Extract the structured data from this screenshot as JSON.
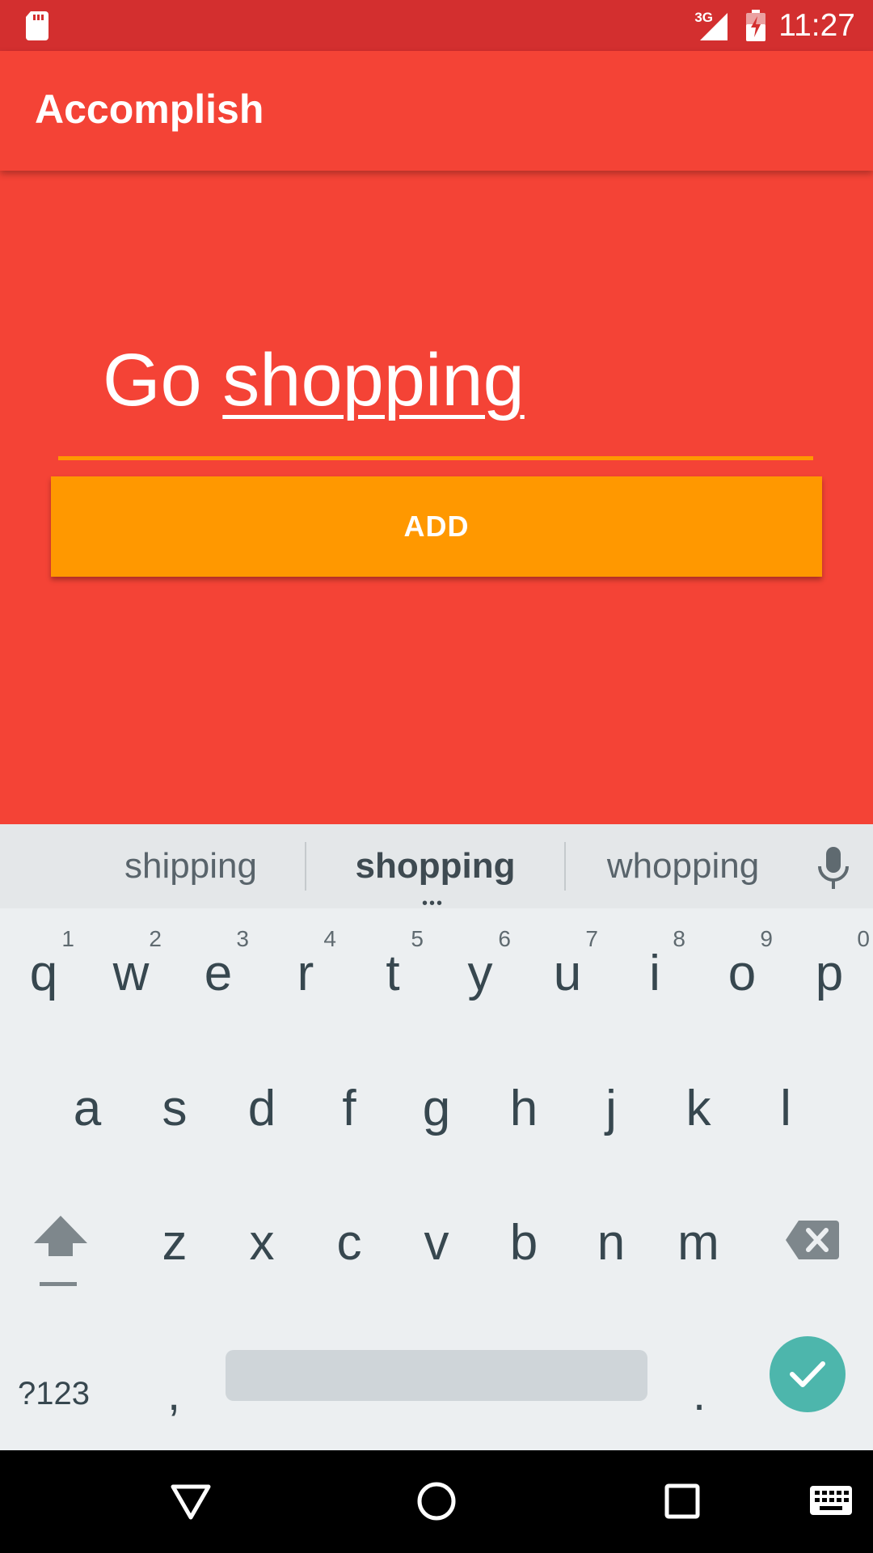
{
  "status_bar": {
    "network_label": "3G",
    "time": "11:27",
    "icons": [
      "sd-card-icon",
      "signal-icon",
      "battery-charging-icon"
    ]
  },
  "app_bar": {
    "title": "Accomplish"
  },
  "task_form": {
    "input_value_prefix": "Go ",
    "input_value_composing": "shopping",
    "add_button_label": "ADD"
  },
  "keyboard": {
    "suggestions": [
      "shipping",
      "shopping",
      "whopping"
    ],
    "row1": [
      {
        "key": "q",
        "hint": "1"
      },
      {
        "key": "w",
        "hint": "2"
      },
      {
        "key": "e",
        "hint": "3"
      },
      {
        "key": "r",
        "hint": "4"
      },
      {
        "key": "t",
        "hint": "5"
      },
      {
        "key": "y",
        "hint": "6"
      },
      {
        "key": "u",
        "hint": "7"
      },
      {
        "key": "i",
        "hint": "8"
      },
      {
        "key": "o",
        "hint": "9"
      },
      {
        "key": "p",
        "hint": "0"
      }
    ],
    "row2": [
      "a",
      "s",
      "d",
      "f",
      "g",
      "h",
      "j",
      "k",
      "l"
    ],
    "row3": [
      "z",
      "x",
      "c",
      "v",
      "b",
      "n",
      "m"
    ],
    "symbols_label": "?123",
    "comma_label": ",",
    "period_label": "."
  },
  "nav_bar": {
    "icons": [
      "back-icon",
      "home-icon",
      "recents-icon",
      "keyboard-switch-icon"
    ]
  },
  "colors": {
    "primary": "#F44336",
    "primary_dark": "#D32F2F",
    "accent": "#FF9800",
    "enter_key": "#4DB6AC"
  }
}
